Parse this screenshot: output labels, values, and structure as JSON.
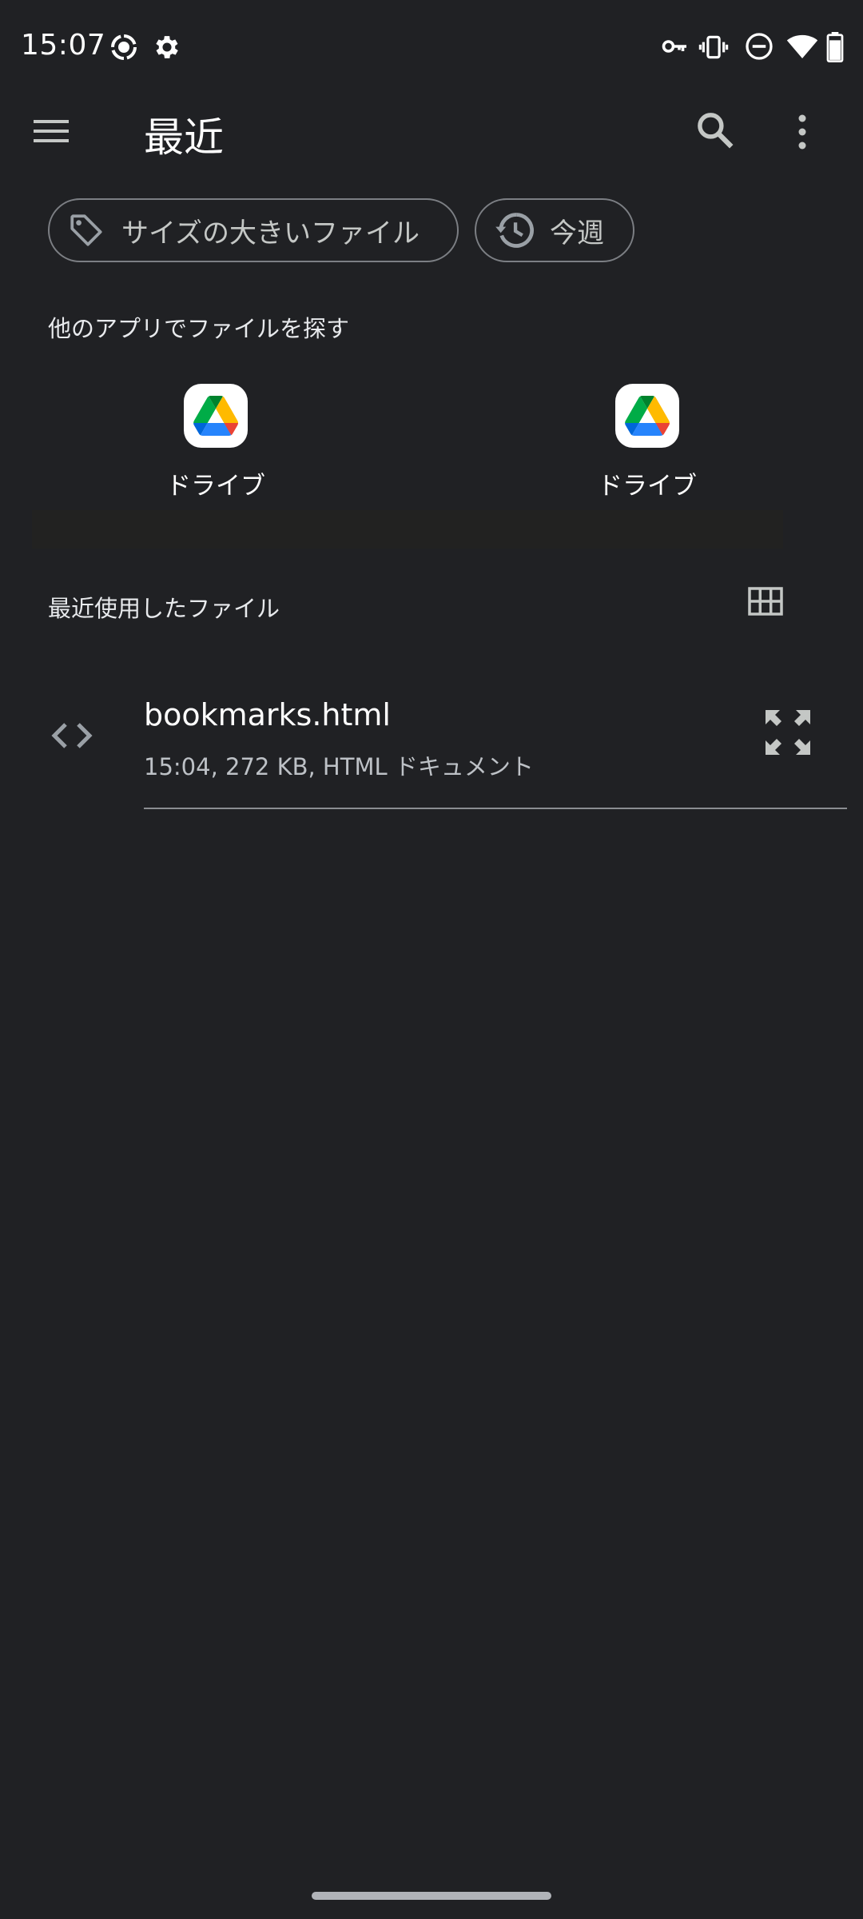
{
  "status_bar": {
    "time": "15:07",
    "left_icons": [
      "screen-record-icon",
      "settings-icon"
    ],
    "right_icons": [
      "vpn-key-icon",
      "vibrate-icon",
      "do-not-disturb-icon",
      "wifi-icon",
      "battery-icon"
    ]
  },
  "app_bar": {
    "title": "最近",
    "icons": [
      "menu-icon",
      "search-icon",
      "more-vert-icon"
    ]
  },
  "filters": {
    "chips": [
      {
        "label": "サイズの大きいファイル",
        "icon": "tag-icon"
      },
      {
        "label": "今週",
        "icon": "history-icon"
      }
    ]
  },
  "other_apps": {
    "heading": "他のアプリでファイルを探す",
    "apps": [
      {
        "label": "ドライブ",
        "icon": "google-drive-icon"
      },
      {
        "label": "ドライブ",
        "icon": "google-drive-icon"
      }
    ]
  },
  "recent": {
    "heading": "最近使用したファイル",
    "view_toggle_icon": "grid-view-icon",
    "files": [
      {
        "name": "bookmarks.html",
        "meta": "15:04, 272 KB, HTML ドキュメント",
        "type_icon": "code-icon",
        "action_icon": "expand-icon"
      }
    ]
  },
  "colors": {
    "background": "#202124",
    "text_primary": "#ffffff",
    "text_secondary": "#bdc1c6",
    "chip_border": "#7c7f84"
  }
}
